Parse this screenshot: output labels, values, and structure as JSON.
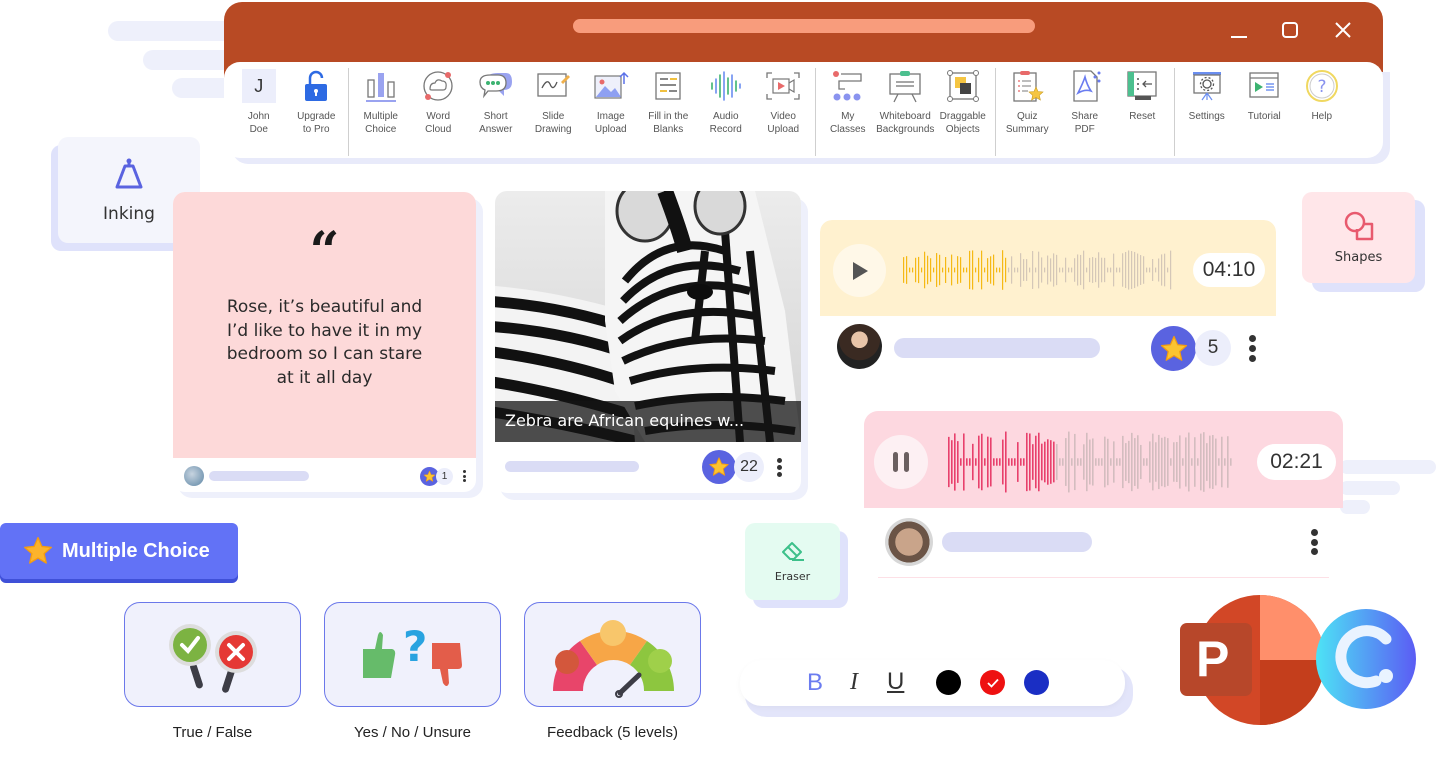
{
  "window": {
    "controls": {
      "minimize": "minimize",
      "maximize": "maximize",
      "close": "close"
    }
  },
  "ribbon": {
    "user": {
      "initial": "J",
      "label": "John\nDoe"
    },
    "groups": [
      [
        {
          "id": "upgrade",
          "label": "Upgrade\nto Pro",
          "icon": "unlock-icon"
        }
      ],
      [
        {
          "id": "multiple-choice",
          "label": "Multiple\nChoice",
          "icon": "bar-chart-icon"
        },
        {
          "id": "word-cloud",
          "label": "Word\nCloud",
          "icon": "word-cloud-icon"
        },
        {
          "id": "short-answer",
          "label": "Short\nAnswer",
          "icon": "chat-bubble-icon"
        },
        {
          "id": "slide-drawing",
          "label": "Slide\nDrawing",
          "icon": "slide-drawing-icon"
        },
        {
          "id": "image-upload",
          "label": "Image\nUpload",
          "icon": "image-upload-icon"
        },
        {
          "id": "fill-blanks",
          "label": "Fill in the\nBlanks",
          "icon": "fill-blanks-icon"
        },
        {
          "id": "audio-record",
          "label": "Audio\nRecord",
          "icon": "audio-wave-icon"
        },
        {
          "id": "video-upload",
          "label": "Video\nUpload",
          "icon": "video-upload-icon"
        }
      ],
      [
        {
          "id": "my-classes",
          "label": "My\nClasses",
          "icon": "classes-icon"
        },
        {
          "id": "whiteboard-backgrounds",
          "label": "Whiteboard\nBackgrounds",
          "icon": "whiteboard-icon"
        },
        {
          "id": "draggable-objects",
          "label": "Draggable\nObjects",
          "icon": "draggable-icon"
        }
      ],
      [
        {
          "id": "quiz-summary",
          "label": "Quiz\nSummary",
          "icon": "quiz-summary-icon"
        },
        {
          "id": "share-pdf",
          "label": "Share\nPDF",
          "icon": "pdf-icon"
        },
        {
          "id": "reset",
          "label": "Reset",
          "icon": "reset-icon"
        }
      ],
      [
        {
          "id": "settings",
          "label": "Settings",
          "icon": "settings-icon"
        },
        {
          "id": "tutorial",
          "label": "Tutorial",
          "icon": "tutorial-icon"
        },
        {
          "id": "help",
          "label": "Help",
          "icon": "help-icon"
        }
      ]
    ]
  },
  "tools": {
    "inking": {
      "label": "Inking",
      "color": "#5a63e0"
    },
    "shapes": {
      "label": "Shapes",
      "color": "#e85a6e"
    },
    "eraser": {
      "label": "Eraser",
      "color": "#3cc08a"
    }
  },
  "cards": {
    "quote": {
      "mark": "“",
      "text": "Rose, it’s beautiful and I’d like to have it in my bedroom so I can stare at it all day",
      "stars": "1",
      "bg": "#fdd9d9"
    },
    "image": {
      "caption": "Zebra are African equines w...",
      "stars": "22"
    },
    "audio1": {
      "time": "04:10",
      "state": "paused",
      "progress": 0.38,
      "stars": "5",
      "bg": "#fff1cf",
      "wave_color": "#f5b914"
    },
    "audio2": {
      "time": "02:21",
      "state": "playing",
      "progress": 0.37,
      "bg": "#fdd8e0",
      "wave_color": "#e8406c"
    }
  },
  "multiple_choice": {
    "badge": "Multiple Choice",
    "options": [
      {
        "label": "True / False"
      },
      {
        "label": "Yes / No / Unsure"
      },
      {
        "label": "Feedback (5 levels)"
      }
    ]
  },
  "format_toolbar": {
    "bold": "B",
    "italic": "I",
    "underline": "U",
    "colors": [
      {
        "name": "black",
        "hex": "#000000",
        "selected": false
      },
      {
        "name": "red",
        "hex": "#ee1111",
        "selected": true
      },
      {
        "name": "blue",
        "hex": "#1a2ec4",
        "selected": false
      }
    ]
  },
  "logos": {
    "powerpoint": "P"
  }
}
